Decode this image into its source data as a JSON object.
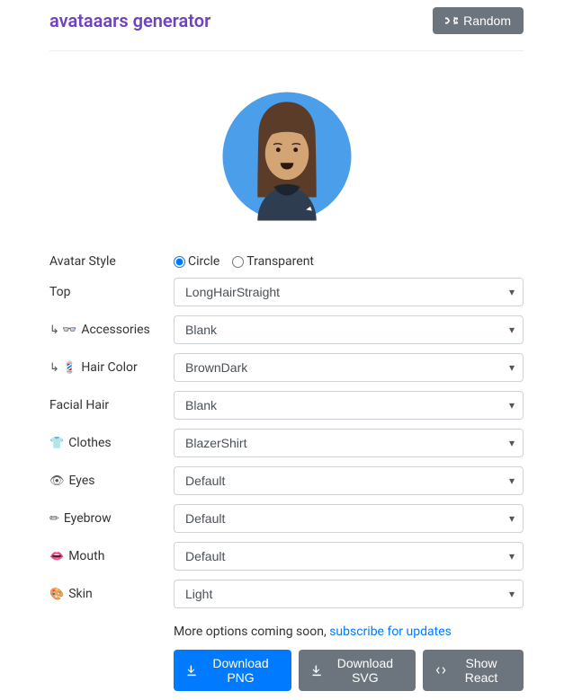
{
  "header": {
    "title": "avataaars generator",
    "random_label": "Random"
  },
  "avatar_style": {
    "label": "Avatar Style",
    "options": [
      {
        "label": "Circle",
        "checked": true
      },
      {
        "label": "Transparent",
        "checked": false
      }
    ]
  },
  "fields": {
    "top": {
      "label": "Top",
      "prefix": "",
      "value": "LongHairStraight"
    },
    "accessories": {
      "label": "Accessories",
      "prefix": "↳ 👓",
      "value": "Blank"
    },
    "hair_color": {
      "label": "Hair Color",
      "prefix": "↳ 💈",
      "value": "BrownDark"
    },
    "facial_hair": {
      "label": "Facial Hair",
      "prefix": "",
      "value": "Blank"
    },
    "clothes": {
      "label": "Clothes",
      "prefix": "👕",
      "value": "BlazerShirt"
    },
    "eyes": {
      "label": "Eyes",
      "prefix": "👁",
      "value": "Default"
    },
    "eyebrow": {
      "label": "Eyebrow",
      "prefix": "✏",
      "value": "Default"
    },
    "mouth": {
      "label": "Mouth",
      "prefix": "👄",
      "value": "Default"
    },
    "skin": {
      "label": "Skin",
      "prefix": "🎨",
      "value": "Light"
    }
  },
  "footer": {
    "more_text": "More options coming soon, ",
    "subscribe_link": "subscribe for updates",
    "download_png": "Download PNG",
    "download_svg": "Download SVG",
    "show_react": "Show React"
  }
}
